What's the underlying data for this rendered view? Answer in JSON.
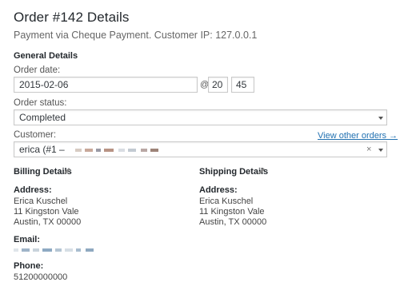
{
  "header": {
    "title": "Order #142 Details",
    "subtitle": "Payment via Cheque Payment. Customer IP: 127.0.0.1"
  },
  "general": {
    "heading": "General Details",
    "order_date_label": "Order date:",
    "order_date": "2015-02-06",
    "at_symbol": "@",
    "hour": "20",
    "colon": ":",
    "minute": "45",
    "order_status_label": "Order status:",
    "order_status": "Completed",
    "customer_label": "Customer:",
    "view_other_orders": "View other orders →",
    "customer_value": "erica (#1 –",
    "clear_symbol": "×"
  },
  "billing": {
    "heading": "Billing Details",
    "address_label": "Address:",
    "address_lines": [
      "Erica Kuschel",
      "11 Kingston Vale",
      "Austin, TX 00000"
    ],
    "email_label": "Email:",
    "phone_label": "Phone:",
    "phone": "51200000000"
  },
  "shipping": {
    "heading": "Shipping Details",
    "address_label": "Address:",
    "address_lines": [
      "Erica Kuschel",
      "11 Kingston Vale",
      "Austin, TX 00000"
    ]
  },
  "icons": {
    "edit": "pencil-icon",
    "dropdown": "chevron-down-icon",
    "clear": "close-icon"
  },
  "colors": {
    "link": "#2271b1",
    "heading": "#23282d",
    "border": "#c9c9c9"
  }
}
